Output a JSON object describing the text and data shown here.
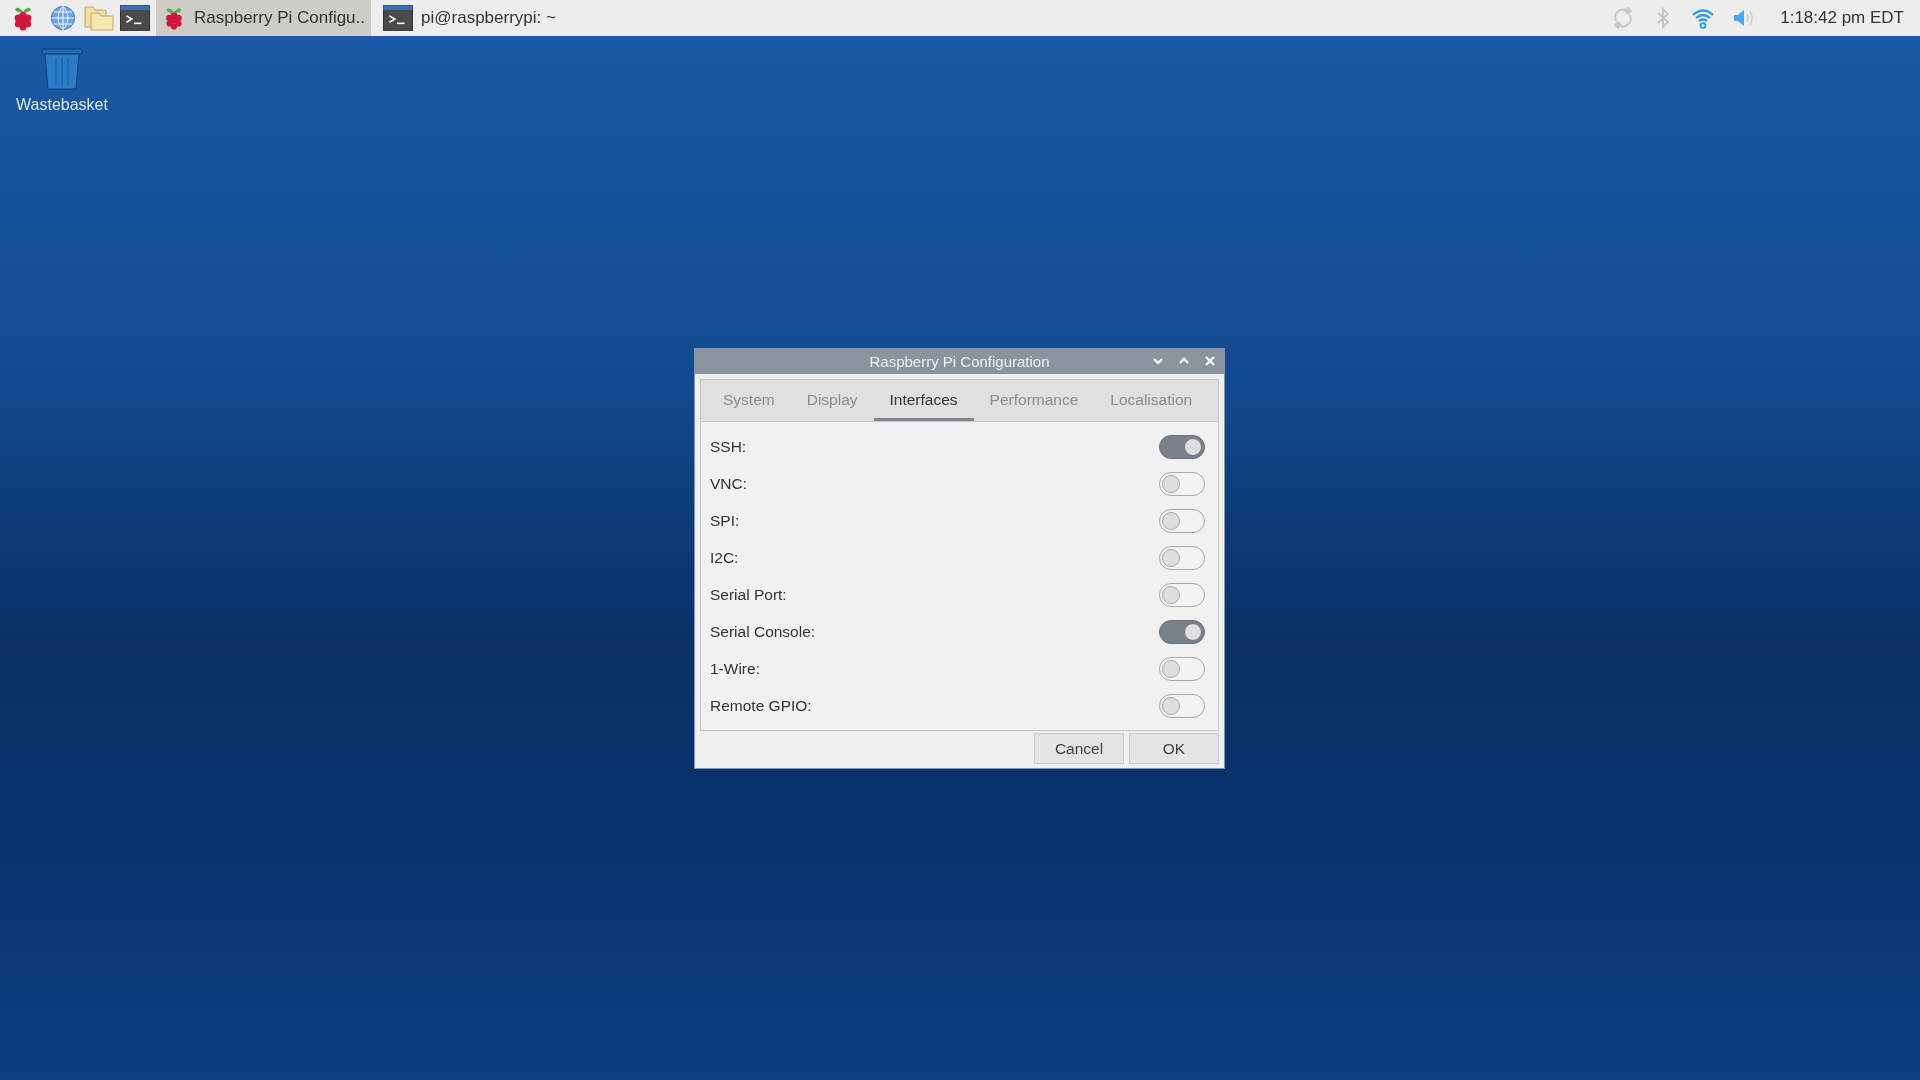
{
  "taskbar": {
    "tasks": [
      {
        "kind": "config",
        "label": "Raspberry Pi Configu..",
        "selected": true
      },
      {
        "kind": "terminal",
        "label": "pi@raspberrypi: ~",
        "selected": false
      }
    ],
    "clock": "1:18:42 pm EDT"
  },
  "desktop_icons": [
    {
      "label": "Wastebasket"
    }
  ],
  "dialog": {
    "title": "Raspberry Pi Configuration",
    "tabs": [
      {
        "label": "System",
        "selected": false
      },
      {
        "label": "Display",
        "selected": false
      },
      {
        "label": "Interfaces",
        "selected": true
      },
      {
        "label": "Performance",
        "selected": false
      },
      {
        "label": "Localisation",
        "selected": false
      }
    ],
    "settings": [
      {
        "label": "SSH:",
        "on": true
      },
      {
        "label": "VNC:",
        "on": false
      },
      {
        "label": "SPI:",
        "on": false
      },
      {
        "label": "I2C:",
        "on": false
      },
      {
        "label": "Serial Port:",
        "on": false
      },
      {
        "label": "Serial Console:",
        "on": true
      },
      {
        "label": "1-Wire:",
        "on": false
      },
      {
        "label": "Remote GPIO:",
        "on": false
      }
    ],
    "buttons": [
      "Cancel",
      "OK"
    ]
  }
}
